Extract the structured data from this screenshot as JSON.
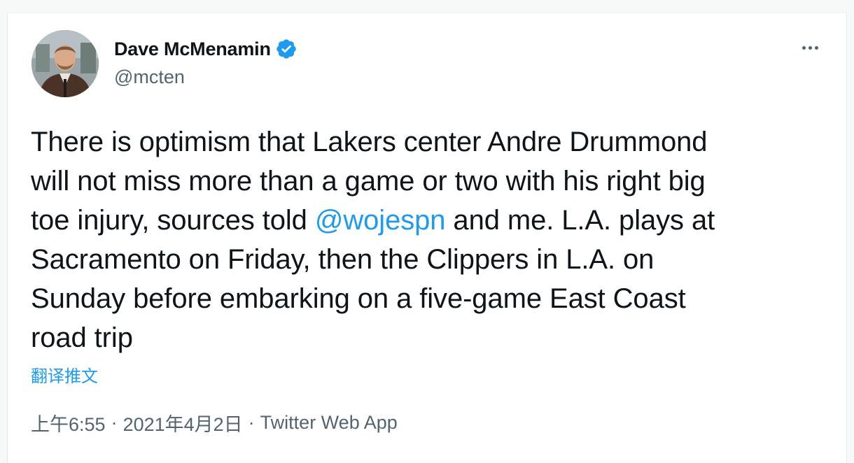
{
  "user": {
    "display_name": "Dave McMenamin",
    "handle": "@mcten",
    "verified": true,
    "avatar_icon": "avatar-photo"
  },
  "actions": {
    "more_icon": "more-options-icon"
  },
  "tweet": {
    "text_before": "There is optimism that Lakers center Andre Drummond\nwill not miss more than a game or two with his right big\ntoe injury, sources told ",
    "mention": "@wojespn",
    "text_after": " and me. L.A. plays at\nSacramento on Friday, then the Clippers in L.A. on\nSunday before embarking on a five-game East Coast\nroad trip",
    "translate_label": "翻译推文"
  },
  "meta": {
    "time": "上午6:55",
    "separator": "·",
    "date": "2021年4月2日",
    "source": "Twitter Web App"
  },
  "colors": {
    "accent": "#1d9bf0",
    "text": "#0f1419",
    "secondary": "#536471"
  }
}
